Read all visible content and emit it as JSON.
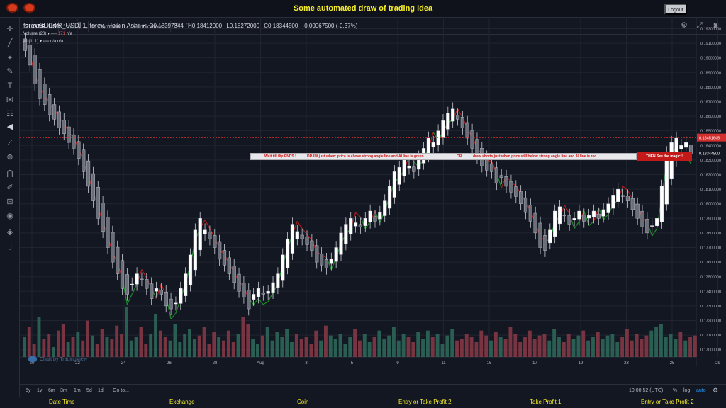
{
  "page": {
    "title": "Some automated draw of trading idea",
    "logout_label": "Logout"
  },
  "toolbar": {
    "symbol": "SUGAR_USD",
    "interval": "1m",
    "compare_label": "Compare",
    "indicators_label": "Indicators"
  },
  "legend": {
    "title": "forex:SUGAR_USD, 1, forex, Heikin Ashi",
    "open": "O0.18397344",
    "high": "H0.18412000",
    "low": "L0.18272000",
    "close": "C0.18344500",
    "change": "-0.00067500 (-0.37%)",
    "volume_label": "Volume (20)",
    "volume_value": "171",
    "volume_na": "n/a",
    "ai_label": "AI (1, 1)",
    "ai_na1": "n/a",
    "ai_na2": "n/a"
  },
  "annotation": {
    "part1": "Wait till flip ENDS  !",
    "part2": "DRAW just when:  price is above strong angle line and AI line is green",
    "part3": "OR",
    "part4": "draw shorts just when price still below strong angle line and AI line is red",
    "part5": "THEN See the magic!!"
  },
  "watermark": "Chart by TradingView",
  "price_axis": {
    "ticks": [
      "0.19200000",
      "0.19100000",
      "0.19000000",
      "0.18900000",
      "0.18800000",
      "0.18700000",
      "0.18600000",
      "0.18500000",
      "0.18400000",
      "0.18300000",
      "0.18200000",
      "0.18100000",
      "0.18000000",
      "0.17900000",
      "0.17800000",
      "0.17700000",
      "0.17600000",
      "0.17500000",
      "0.17400000",
      "0.17300000",
      "0.17200000",
      "0.17100000",
      "0.17000000"
    ],
    "marker_red": "0.18451645",
    "marker_dark": "0.18344500"
  },
  "time_axis": {
    "labels": [
      "20",
      "22",
      "24",
      "26",
      "28",
      "Aug",
      "3",
      "5",
      "9",
      "11",
      "15",
      "17",
      "19",
      "23",
      "25",
      "29",
      "09:"
    ]
  },
  "timeframes": {
    "items": [
      "5y",
      "1y",
      "6m",
      "3m",
      "1m",
      "5d",
      "1d"
    ],
    "goto": "Go to...",
    "clock": "10:00:52 (UTC)",
    "pct": "%",
    "log": "log",
    "auto": "auto"
  },
  "columns": [
    "Date Time",
    "Exchange",
    "Coin",
    "Entry or Take Profit 2",
    "Take Profit 1",
    "Entry or Take Profit 2"
  ],
  "colors": {
    "up": "#ffffff",
    "down": "#6b6f7a",
    "ai_green": "#1e8c2a",
    "ai_red": "#b01e1e",
    "vol_up": "#2f6b5a",
    "vol_down": "#8b3a46",
    "accent": "#f6ee2a"
  },
  "chart_data": {
    "type": "candlestick",
    "style": "Heikin Ashi",
    "ylim": [
      0.1695,
      0.1928
    ],
    "closes": [
      0.1905,
      0.1895,
      0.1882,
      0.1872,
      0.1868,
      0.1861,
      0.1858,
      0.1852,
      0.1848,
      0.1842,
      0.1838,
      0.1831,
      0.1822,
      0.1812,
      0.1802,
      0.179,
      0.1781,
      0.177,
      0.176,
      0.1752,
      0.1742,
      0.1738,
      0.1745,
      0.1752,
      0.1748,
      0.1742,
      0.1735,
      0.1742,
      0.1738,
      0.173,
      0.1728,
      0.1732,
      0.1742,
      0.1752,
      0.1765,
      0.1782,
      0.179,
      0.1782,
      0.1776,
      0.177,
      0.1762,
      0.1758,
      0.1752,
      0.1746,
      0.174,
      0.1736,
      0.1728,
      0.1738,
      0.1742,
      0.1738,
      0.174,
      0.1746,
      0.1752,
      0.1765,
      0.1776,
      0.1786,
      0.1781,
      0.1776,
      0.1772,
      0.1768,
      0.176,
      0.1758,
      0.1756,
      0.1762,
      0.177,
      0.178,
      0.1786,
      0.179,
      0.1787,
      0.1784,
      0.179,
      0.1795,
      0.1788,
      0.1794,
      0.1802,
      0.1812,
      0.1822,
      0.1825,
      0.183,
      0.1826,
      0.1822,
      0.1832,
      0.1838,
      0.1845,
      0.1842,
      0.185,
      0.1857,
      0.1862,
      0.1865,
      0.1858,
      0.1852,
      0.1845,
      0.1838,
      0.1832,
      0.1826,
      0.1823,
      0.1822,
      0.1814,
      0.1818,
      0.1812,
      0.1808,
      0.1805,
      0.18,
      0.1794,
      0.1788,
      0.178,
      0.177,
      0.1768,
      0.1782,
      0.1795,
      0.1798,
      0.1792,
      0.1786,
      0.179,
      0.1795,
      0.1788,
      0.1792,
      0.1795,
      0.179,
      0.1796,
      0.18,
      0.1806,
      0.181,
      0.1805,
      0.1802,
      0.1796,
      0.179,
      0.1784,
      0.178,
      0.1785,
      0.179,
      0.1812,
      0.1835,
      0.1842,
      0.1845,
      0.184,
      0.1842,
      0.1834
    ],
    "ai_line_colors": [
      "red",
      "red",
      "red",
      "red",
      "red",
      "red",
      "red",
      "red",
      "red",
      "red",
      "red",
      "red",
      "red",
      "red",
      "red",
      "red",
      "red",
      "red",
      "red",
      "red",
      "red",
      "green",
      "green",
      "green",
      "red",
      "red",
      "red",
      "green",
      "red",
      "red",
      "green",
      "green",
      "green",
      "green",
      "green",
      "green",
      "green",
      "red",
      "red",
      "red",
      "red",
      "red",
      "red",
      "red",
      "red",
      "red",
      "red",
      "green",
      "green",
      "green",
      "green",
      "green",
      "green",
      "green",
      "green",
      "green",
      "red",
      "red",
      "red",
      "red",
      "red",
      "red",
      "red",
      "green",
      "green",
      "green",
      "green",
      "green",
      "red",
      "red",
      "green",
      "green",
      "red",
      "green",
      "green",
      "green",
      "green",
      "green",
      "green",
      "red",
      "red",
      "green",
      "green",
      "green",
      "red",
      "green",
      "green",
      "green",
      "green",
      "red",
      "red",
      "red",
      "red",
      "red",
      "red",
      "red",
      "red",
      "red",
      "green",
      "red",
      "red",
      "red",
      "red",
      "red",
      "red",
      "red",
      "red",
      "red",
      "green",
      "green",
      "green",
      "red",
      "red",
      "green",
      "green",
      "red",
      "green",
      "green",
      "red",
      "green",
      "green",
      "green",
      "green",
      "red",
      "red",
      "red",
      "red",
      "red",
      "red",
      "green",
      "green",
      "green",
      "green",
      "green",
      "green",
      "green",
      "green",
      "green"
    ],
    "volumes": [
      60,
      90,
      40,
      120,
      55,
      70,
      30,
      80,
      100,
      45,
      60,
      75,
      50,
      110,
      65,
      40,
      85,
      60,
      55,
      95,
      70,
      150,
      50,
      60,
      90,
      40,
      70,
      130,
      80,
      60,
      50,
      100,
      45,
      70,
      85,
      55,
      65,
      90,
      40,
      75,
      60,
      50,
      80,
      45,
      70,
      120,
      100,
      55,
      40,
      65,
      90,
      50,
      75,
      60,
      85,
      45,
      70,
      55,
      60,
      40,
      80,
      50,
      95,
      65,
      55,
      70,
      40,
      60,
      85,
      50,
      70,
      45,
      60,
      80,
      55,
      65,
      90,
      50,
      70,
      60,
      45,
      75,
      55,
      80,
      60,
      70,
      40,
      65,
      85,
      50,
      55,
      70,
      60,
      45,
      80,
      65,
      50,
      75,
      60,
      55,
      90,
      70,
      45,
      60,
      80,
      55,
      65,
      70,
      50,
      85,
      60,
      45,
      70,
      55,
      65,
      80,
      50,
      60,
      75,
      55,
      65,
      70,
      45,
      60,
      85,
      50,
      70,
      55,
      65,
      80,
      90,
      100,
      60,
      70,
      55,
      75,
      50,
      60,
      65
    ],
    "volume_up": [
      true,
      false,
      false,
      true,
      false,
      false,
      true,
      false,
      false,
      true,
      false,
      true,
      false,
      false,
      true,
      false,
      false,
      true,
      false,
      false,
      false,
      true,
      true,
      true,
      false,
      false,
      true,
      true,
      false,
      false,
      true,
      true,
      true,
      true,
      true,
      true,
      false,
      false,
      false,
      false,
      true,
      false,
      false,
      false,
      true,
      false,
      false,
      true,
      true,
      false,
      true,
      true,
      true,
      true,
      true,
      true,
      false,
      false,
      false,
      false,
      false,
      true,
      false,
      true,
      true,
      true,
      true,
      true,
      false,
      false,
      true,
      true,
      false,
      true,
      true,
      true,
      true,
      true,
      true,
      false,
      false,
      true,
      true,
      true,
      false,
      true,
      true,
      true,
      true,
      false,
      false,
      false,
      false,
      false,
      false,
      false,
      true,
      false,
      true,
      false,
      false,
      false,
      false,
      false,
      false,
      false,
      false,
      false,
      true,
      true,
      true,
      false,
      false,
      true,
      true,
      false,
      true,
      true,
      false,
      true,
      true,
      true,
      true,
      false,
      false,
      false,
      false,
      false,
      false,
      true,
      true,
      true,
      true,
      true,
      true,
      false,
      true,
      false
    ]
  }
}
